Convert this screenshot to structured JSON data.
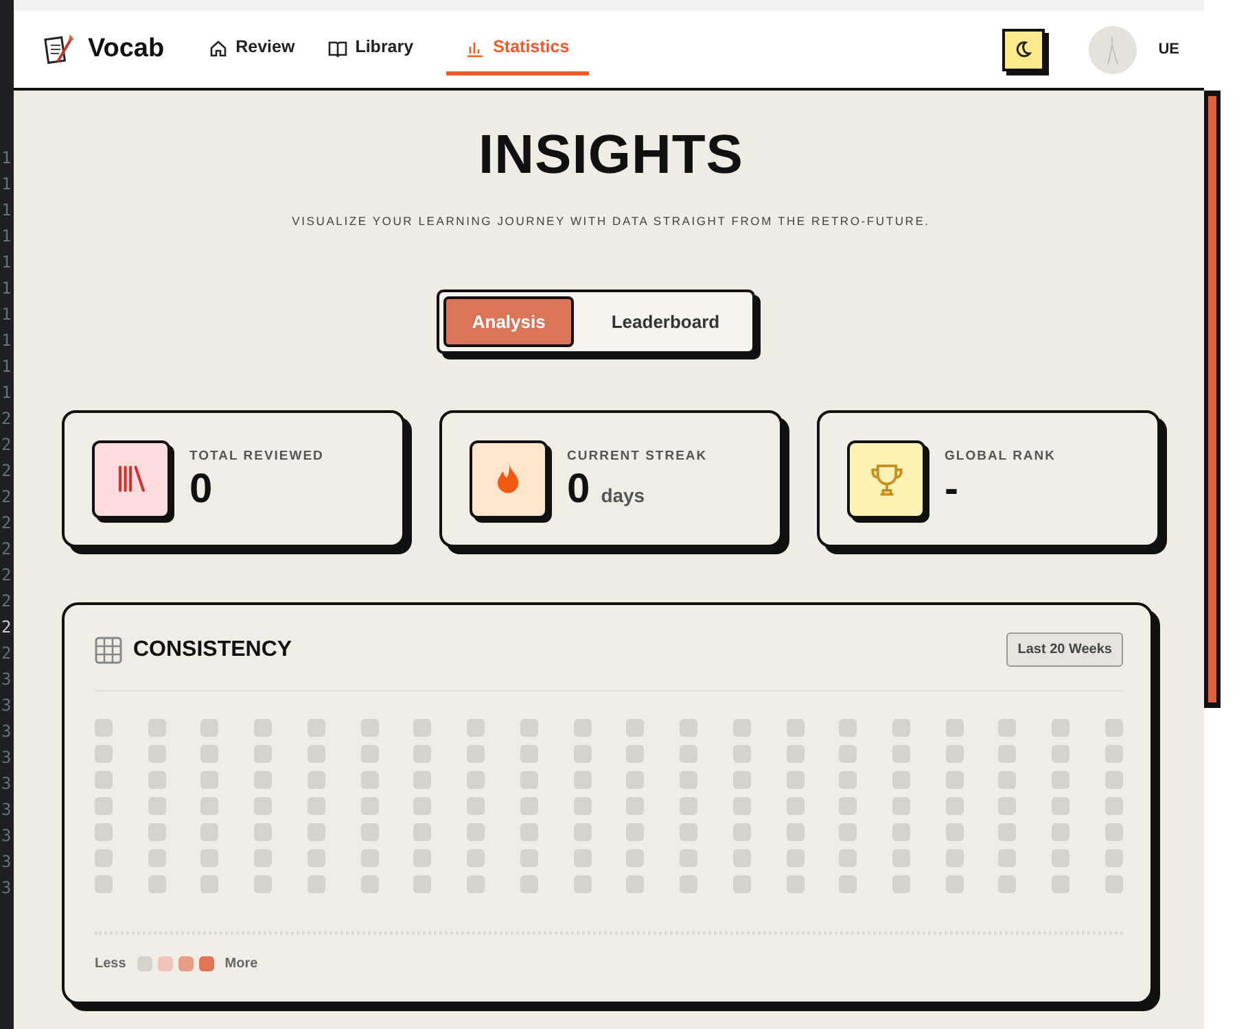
{
  "gutter": [
    {
      "text": "1",
      "current": false
    },
    {
      "text": "1",
      "current": false
    },
    {
      "text": "1",
      "current": false
    },
    {
      "text": "1",
      "current": false
    },
    {
      "text": "1",
      "current": false
    },
    {
      "text": "1",
      "current": false
    },
    {
      "text": "1",
      "current": false
    },
    {
      "text": "1",
      "current": false
    },
    {
      "text": "1",
      "current": false
    },
    {
      "text": "1",
      "current": false
    },
    {
      "text": "2",
      "current": false
    },
    {
      "text": "2",
      "current": false
    },
    {
      "text": "2",
      "current": false
    },
    {
      "text": "2",
      "current": false
    },
    {
      "text": "2",
      "current": false
    },
    {
      "text": "2",
      "current": false
    },
    {
      "text": "2",
      "current": false
    },
    {
      "text": "2",
      "current": false
    },
    {
      "text": "2",
      "current": true
    },
    {
      "text": "2",
      "current": false
    },
    {
      "text": "3",
      "current": false
    },
    {
      "text": "3",
      "current": false
    },
    {
      "text": "3",
      "current": false
    },
    {
      "text": "3",
      "current": false
    },
    {
      "text": "3",
      "current": false
    },
    {
      "text": "3",
      "current": false
    },
    {
      "text": "3",
      "current": false
    },
    {
      "text": "3",
      "current": false
    },
    {
      "text": "3",
      "current": false
    }
  ],
  "brand": "Vocab",
  "nav": [
    {
      "label": "Review",
      "selected": false
    },
    {
      "label": "Library",
      "selected": false
    },
    {
      "label": "Statistics",
      "selected": true
    }
  ],
  "user": {
    "initials": "UE"
  },
  "title": "INSIGHTS",
  "subtitle": "VISUALIZE YOUR LEARNING JOURNEY WITH DATA STRAIGHT FROM THE RETRO-FUTURE.",
  "tabs": [
    {
      "label": "Analysis",
      "selected": true
    },
    {
      "label": "Leaderboard",
      "selected": false
    }
  ],
  "stats": [
    {
      "kind": "books",
      "label": "TOTAL REVIEWED",
      "value": "0"
    },
    {
      "kind": "flame",
      "label": "CURRENT STREAK",
      "value": "0",
      "unit": "days"
    },
    {
      "kind": "trophy",
      "label": "GLOBAL RANK",
      "value": "-"
    }
  ],
  "consistency": {
    "title": "CONSISTENCY",
    "range": "Last 20 Weeks",
    "weeks": [
      {
        "days": [
          {
            "color": "#d6d3cc"
          },
          {
            "color": "#d6d3cc"
          },
          {
            "color": "#d6d3cc"
          },
          {
            "color": "#d6d3cc"
          },
          {
            "color": "#d6d3cc"
          },
          {
            "color": "#d6d3cc"
          },
          {
            "color": "#d6d3cc"
          }
        ]
      },
      {
        "days": [
          {
            "color": "#d6d3cc"
          },
          {
            "color": "#d6d3cc"
          },
          {
            "color": "#d6d3cc"
          },
          {
            "color": "#d6d3cc"
          },
          {
            "color": "#d6d3cc"
          },
          {
            "color": "#d6d3cc"
          },
          {
            "color": "#d6d3cc"
          }
        ]
      },
      {
        "days": [
          {
            "color": "#d6d3cc"
          },
          {
            "color": "#d6d3cc"
          },
          {
            "color": "#d6d3cc"
          },
          {
            "color": "#d6d3cc"
          },
          {
            "color": "#d6d3cc"
          },
          {
            "color": "#d6d3cc"
          },
          {
            "color": "#d6d3cc"
          }
        ]
      },
      {
        "days": [
          {
            "color": "#d6d3cc"
          },
          {
            "color": "#d6d3cc"
          },
          {
            "color": "#d6d3cc"
          },
          {
            "color": "#d6d3cc"
          },
          {
            "color": "#d6d3cc"
          },
          {
            "color": "#d6d3cc"
          },
          {
            "color": "#d6d3cc"
          }
        ]
      },
      {
        "days": [
          {
            "color": "#d6d3cc"
          },
          {
            "color": "#d6d3cc"
          },
          {
            "color": "#d6d3cc"
          },
          {
            "color": "#d6d3cc"
          },
          {
            "color": "#d6d3cc"
          },
          {
            "color": "#d6d3cc"
          },
          {
            "color": "#d6d3cc"
          }
        ]
      },
      {
        "days": [
          {
            "color": "#d6d3cc"
          },
          {
            "color": "#d6d3cc"
          },
          {
            "color": "#d6d3cc"
          },
          {
            "color": "#d6d3cc"
          },
          {
            "color": "#d6d3cc"
          },
          {
            "color": "#d6d3cc"
          },
          {
            "color": "#d6d3cc"
          }
        ]
      },
      {
        "days": [
          {
            "color": "#d6d3cc"
          },
          {
            "color": "#d6d3cc"
          },
          {
            "color": "#d6d3cc"
          },
          {
            "color": "#d6d3cc"
          },
          {
            "color": "#d6d3cc"
          },
          {
            "color": "#d6d3cc"
          },
          {
            "color": "#d6d3cc"
          }
        ]
      },
      {
        "days": [
          {
            "color": "#d6d3cc"
          },
          {
            "color": "#d6d3cc"
          },
          {
            "color": "#d6d3cc"
          },
          {
            "color": "#d6d3cc"
          },
          {
            "color": "#d6d3cc"
          },
          {
            "color": "#d6d3cc"
          },
          {
            "color": "#d6d3cc"
          }
        ]
      },
      {
        "days": [
          {
            "color": "#d6d3cc"
          },
          {
            "color": "#d6d3cc"
          },
          {
            "color": "#d6d3cc"
          },
          {
            "color": "#d6d3cc"
          },
          {
            "color": "#d6d3cc"
          },
          {
            "color": "#d6d3cc"
          },
          {
            "color": "#d6d3cc"
          }
        ]
      },
      {
        "days": [
          {
            "color": "#d6d3cc"
          },
          {
            "color": "#d6d3cc"
          },
          {
            "color": "#d6d3cc"
          },
          {
            "color": "#d6d3cc"
          },
          {
            "color": "#d6d3cc"
          },
          {
            "color": "#d6d3cc"
          },
          {
            "color": "#d6d3cc"
          }
        ]
      },
      {
        "days": [
          {
            "color": "#d6d3cc"
          },
          {
            "color": "#d6d3cc"
          },
          {
            "color": "#d6d3cc"
          },
          {
            "color": "#d6d3cc"
          },
          {
            "color": "#d6d3cc"
          },
          {
            "color": "#d6d3cc"
          },
          {
            "color": "#d6d3cc"
          }
        ]
      },
      {
        "days": [
          {
            "color": "#d6d3cc"
          },
          {
            "color": "#d6d3cc"
          },
          {
            "color": "#d6d3cc"
          },
          {
            "color": "#d6d3cc"
          },
          {
            "color": "#d6d3cc"
          },
          {
            "color": "#d6d3cc"
          },
          {
            "color": "#d6d3cc"
          }
        ]
      },
      {
        "days": [
          {
            "color": "#d6d3cc"
          },
          {
            "color": "#d6d3cc"
          },
          {
            "color": "#d6d3cc"
          },
          {
            "color": "#d6d3cc"
          },
          {
            "color": "#d6d3cc"
          },
          {
            "color": "#d6d3cc"
          },
          {
            "color": "#d6d3cc"
          }
        ]
      },
      {
        "days": [
          {
            "color": "#d6d3cc"
          },
          {
            "color": "#d6d3cc"
          },
          {
            "color": "#d6d3cc"
          },
          {
            "color": "#d6d3cc"
          },
          {
            "color": "#d6d3cc"
          },
          {
            "color": "#d6d3cc"
          },
          {
            "color": "#d6d3cc"
          }
        ]
      },
      {
        "days": [
          {
            "color": "#d6d3cc"
          },
          {
            "color": "#d6d3cc"
          },
          {
            "color": "#d6d3cc"
          },
          {
            "color": "#d6d3cc"
          },
          {
            "color": "#d6d3cc"
          },
          {
            "color": "#d6d3cc"
          },
          {
            "color": "#d6d3cc"
          }
        ]
      },
      {
        "days": [
          {
            "color": "#d6d3cc"
          },
          {
            "color": "#d6d3cc"
          },
          {
            "color": "#d6d3cc"
          },
          {
            "color": "#d6d3cc"
          },
          {
            "color": "#d6d3cc"
          },
          {
            "color": "#d6d3cc"
          },
          {
            "color": "#d6d3cc"
          }
        ]
      },
      {
        "days": [
          {
            "color": "#d6d3cc"
          },
          {
            "color": "#d6d3cc"
          },
          {
            "color": "#d6d3cc"
          },
          {
            "color": "#d6d3cc"
          },
          {
            "color": "#d6d3cc"
          },
          {
            "color": "#d6d3cc"
          },
          {
            "color": "#d6d3cc"
          }
        ]
      },
      {
        "days": [
          {
            "color": "#d6d3cc"
          },
          {
            "color": "#d6d3cc"
          },
          {
            "color": "#d6d3cc"
          },
          {
            "color": "#d6d3cc"
          },
          {
            "color": "#d6d3cc"
          },
          {
            "color": "#d6d3cc"
          },
          {
            "color": "#d6d3cc"
          }
        ]
      },
      {
        "days": [
          {
            "color": "#d6d3cc"
          },
          {
            "color": "#d6d3cc"
          },
          {
            "color": "#d6d3cc"
          },
          {
            "color": "#d6d3cc"
          },
          {
            "color": "#d6d3cc"
          },
          {
            "color": "#d6d3cc"
          },
          {
            "color": "#d6d3cc"
          }
        ]
      },
      {
        "days": [
          {
            "color": "#d6d3cc"
          },
          {
            "color": "#d6d3cc"
          },
          {
            "color": "#d6d3cc"
          },
          {
            "color": "#d6d3cc"
          },
          {
            "color": "#d6d3cc"
          },
          {
            "color": "#d6d3cc"
          },
          {
            "color": "#d6d3cc"
          }
        ]
      }
    ],
    "legend": {
      "less": "Less",
      "more": "More",
      "swatches": [
        {
          "color": "#d6d3cc"
        },
        {
          "color": "#f0c4b8"
        },
        {
          "color": "#e89c86"
        },
        {
          "color": "#df7554"
        }
      ]
    }
  }
}
